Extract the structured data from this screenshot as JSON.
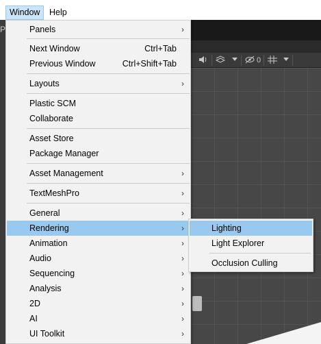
{
  "menubar": {
    "items": [
      {
        "label": "Window"
      },
      {
        "label": "Help"
      }
    ]
  },
  "editor": {
    "left_fragment": "P",
    "toolbar_icons": [
      "speaker-icon",
      "effects-icon",
      "dropdown-arrow-icon",
      "visibility-icon",
      "grid-icon",
      "dropdown-arrow-icon"
    ],
    "hidden_count": "0"
  },
  "window_menu": {
    "items": [
      {
        "label": "Panels",
        "arrow": "›"
      },
      {
        "label": "Next Window",
        "accel": "Ctrl+Tab"
      },
      {
        "label": "Previous Window",
        "accel": "Ctrl+Shift+Tab"
      },
      {
        "label": "Layouts",
        "arrow": "›"
      },
      {
        "label": "Plastic SCM"
      },
      {
        "label": "Collaborate"
      },
      {
        "label": "Asset Store"
      },
      {
        "label": "Package Manager"
      },
      {
        "label": "Asset Management",
        "arrow": "›"
      },
      {
        "label": "TextMeshPro",
        "arrow": "›"
      },
      {
        "label": "General",
        "arrow": "›"
      },
      {
        "label": "Rendering",
        "arrow": "›"
      },
      {
        "label": "Animation",
        "arrow": "›"
      },
      {
        "label": "Audio",
        "arrow": "›"
      },
      {
        "label": "Sequencing",
        "arrow": "›"
      },
      {
        "label": "Analysis",
        "arrow": "›"
      },
      {
        "label": "2D",
        "arrow": "›"
      },
      {
        "label": "AI",
        "arrow": "›"
      },
      {
        "label": "UI Toolkit",
        "arrow": "›"
      }
    ]
  },
  "rendering_submenu": {
    "items": [
      {
        "label": "Lighting"
      },
      {
        "label": "Light Explorer"
      },
      {
        "label": "Occlusion Culling"
      }
    ]
  },
  "colors": {
    "highlight": "#99c9ef",
    "menu_bg": "#f2f2f2",
    "editor_dark": "#191919"
  }
}
